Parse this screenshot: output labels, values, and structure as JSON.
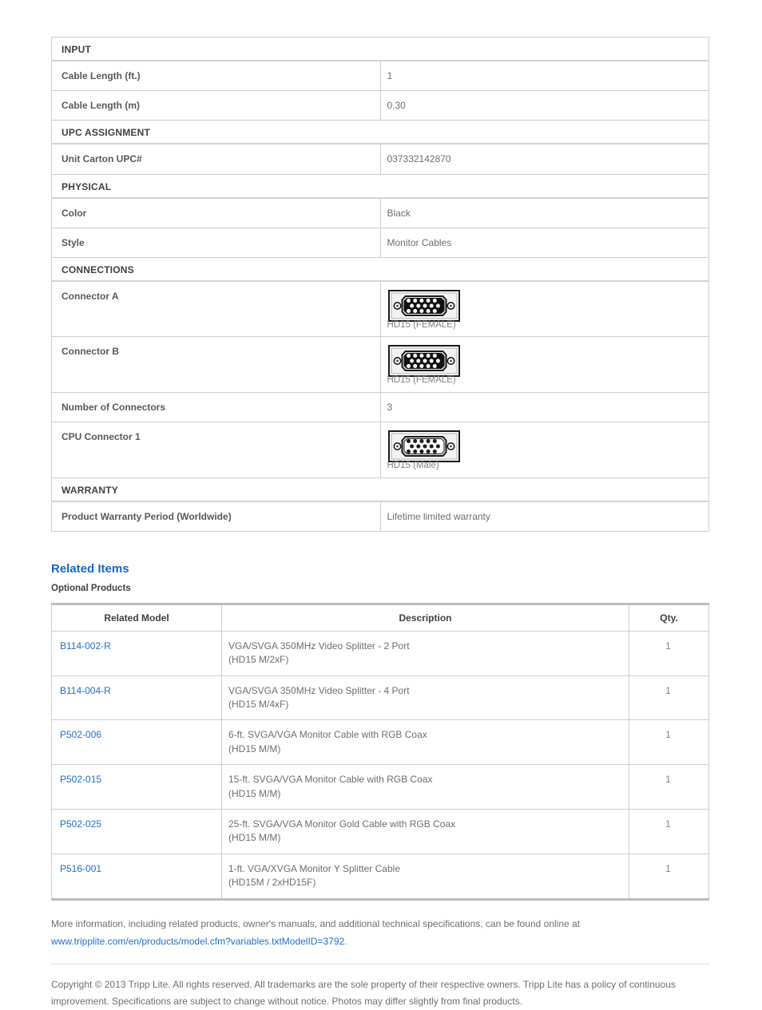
{
  "spec_table": {
    "sections": [
      {
        "title": "INPUT",
        "rows": [
          {
            "label": "Cable Length (ft.)",
            "value": "1",
            "type": "text"
          },
          {
            "label": "Cable Length (m)",
            "value": "0.30",
            "type": "text"
          }
        ]
      },
      {
        "title": "UPC ASSIGNMENT",
        "rows": [
          {
            "label": "Unit Carton UPC#",
            "value": "037332142870",
            "type": "text"
          }
        ]
      },
      {
        "title": "PHYSICAL",
        "rows": [
          {
            "label": "Color",
            "value": "Black",
            "type": "text"
          },
          {
            "label": "Style",
            "value": "Monitor Cables",
            "type": "text"
          }
        ]
      },
      {
        "title": "CONNECTIONS",
        "rows": [
          {
            "label": "Connector A",
            "value": "HD15 (FEMALE)",
            "type": "connector",
            "gender": "female"
          },
          {
            "label": "Connector B",
            "value": "HD15 (FEMALE)",
            "type": "connector",
            "gender": "female"
          },
          {
            "label": "Number of Connectors",
            "value": "3",
            "type": "text"
          },
          {
            "label": "CPU Connector 1",
            "value": "HD15 (Male)",
            "type": "connector",
            "gender": "male"
          }
        ]
      },
      {
        "title": "WARRANTY",
        "rows": [
          {
            "label": "Product Warranty Period (Worldwide)",
            "value": "Lifetime limited warranty",
            "type": "text"
          }
        ]
      }
    ]
  },
  "related": {
    "heading": "Related Items",
    "subheading": "Optional Products",
    "columns": {
      "model": "Related Model",
      "description": "Description",
      "qty": "Qty."
    },
    "rows": [
      {
        "model": "B114-002-R",
        "description_line1": "VGA/SVGA 350MHz Video Splitter - 2 Port",
        "description_line2": "(HD15 M/2xF)",
        "qty": "1"
      },
      {
        "model": "B114-004-R",
        "description_line1": "VGA/SVGA 350MHz Video Splitter - 4 Port",
        "description_line2": "(HD15 M/4xF)",
        "qty": "1"
      },
      {
        "model": "P502-006",
        "description_line1": "6-ft. SVGA/VGA Monitor Cable with RGB Coax",
        "description_line2": "(HD15 M/M)",
        "qty": "1"
      },
      {
        "model": "P502-015",
        "description_line1": "15-ft. SVGA/VGA Monitor Cable with RGB Coax",
        "description_line2": "(HD15 M/M)",
        "qty": "1"
      },
      {
        "model": "P502-025",
        "description_line1": "25-ft. SVGA/VGA Monitor Gold Cable with RGB Coax",
        "description_line2": "(HD15 M/M)",
        "qty": "1"
      },
      {
        "model": "P516-001",
        "description_line1": "1-ft. VGA/XVGA Monitor Y Splitter Cable",
        "description_line2": "(HD15M / 2xHD15F)",
        "qty": "1"
      }
    ]
  },
  "footer": {
    "more_info_text": "More information, including related products, owner's manuals, and additional technical specifications, can be found online at",
    "more_info_link": "www.tripplite.com/en/products/model.cfm?variables.txtModelID=3792",
    "more_info_period": ".",
    "copyright": "Copyright © 2013 Tripp Lite. All rights reserved. All trademarks are the sole property of their respective owners. Tripp Lite has a policy of continuous improvement. Specifications are subject to change without notice. Photos may differ slightly from final products."
  },
  "colors": {
    "link_blue": "#1f6fd0",
    "heading_blue": "#1568c8",
    "border_gray": "#cdcdcd",
    "text_gray": "#6d6e71"
  }
}
